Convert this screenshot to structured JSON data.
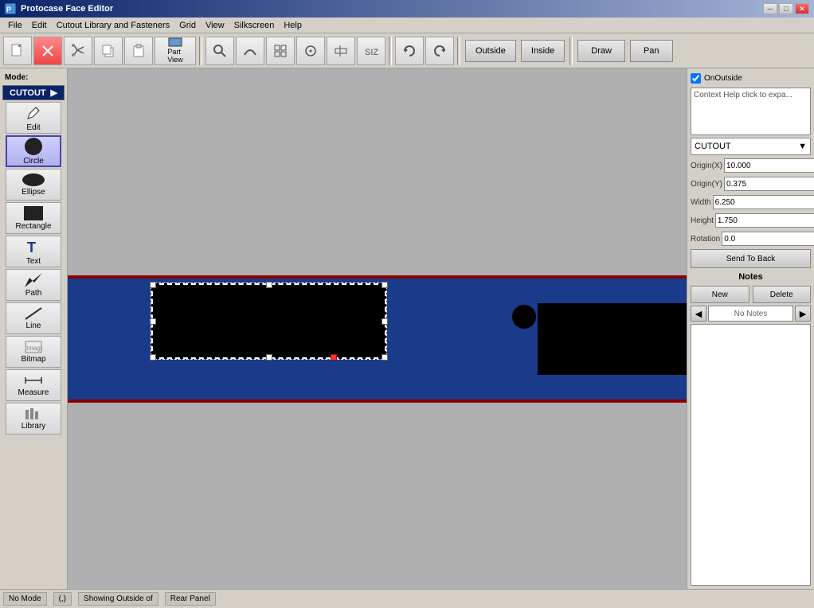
{
  "window": {
    "title": "Protocase Face Editor",
    "icon": "P"
  },
  "menu": {
    "items": [
      "File",
      "Edit",
      "Cutout Library and Fasteners",
      "Grid",
      "View",
      "Silkscreen",
      "Help"
    ]
  },
  "toolbar": {
    "buttons": [
      {
        "label": "🖼",
        "name": "new",
        "tooltip": "New"
      },
      {
        "label": "✕",
        "name": "close",
        "tooltip": "Close"
      },
      {
        "label": "✂",
        "name": "cut"
      },
      {
        "label": "📋",
        "name": "copy"
      },
      {
        "label": "📄",
        "name": "paste"
      },
      {
        "label": "Part\nView",
        "name": "part-view",
        "wide": true
      },
      {
        "label": "🔍",
        "name": "zoom"
      },
      {
        "label": "↩",
        "name": "curve"
      },
      {
        "label": "⊞",
        "name": "grid"
      },
      {
        "label": "⊡",
        "name": "snap"
      },
      {
        "label": "⊞",
        "name": "grid2"
      },
      {
        "label": "↩",
        "name": "undo"
      },
      {
        "label": "↪",
        "name": "redo"
      }
    ],
    "view_buttons": [
      "Outside",
      "Inside"
    ],
    "action_buttons": [
      "Draw",
      "Pan"
    ]
  },
  "mode": {
    "label": "Mode:",
    "active": "CUTOUT"
  },
  "tools": [
    {
      "label": "Edit",
      "name": "edit"
    },
    {
      "label": "Circle",
      "name": "circle",
      "active": true
    },
    {
      "label": "Ellipse",
      "name": "ellipse"
    },
    {
      "label": "Rectangle",
      "name": "rectangle"
    },
    {
      "label": "Text",
      "name": "text"
    },
    {
      "label": "Path",
      "name": "path"
    },
    {
      "label": "Line",
      "name": "line"
    },
    {
      "label": "Bitmap",
      "name": "bitmap"
    },
    {
      "label": "Measure",
      "name": "measure"
    },
    {
      "label": "Library",
      "name": "library"
    }
  ],
  "right_panel": {
    "on_outside_checked": true,
    "on_outside_label": "OnOutside",
    "context_help": "Context Help click to expa...",
    "cutout_dropdown": "CUTOUT",
    "origin_x_label": "Origin(X)",
    "origin_x_value": "10.000",
    "origin_y_label": "Origin(Y)",
    "origin_y_value": "0.375",
    "width_label": "Width",
    "width_value": "6.250",
    "height_label": "Height",
    "height_value": "1.750",
    "rotation_label": "Rotation",
    "rotation_value": "0.0",
    "send_to_back": "Send To Back",
    "notes_header": "Notes",
    "new_note_label": "New",
    "delete_note_label": "Delete",
    "no_notes_label": "No Notes",
    "notes_content": ""
  },
  "status_bar": {
    "items": [
      "No Mode",
      "(,)",
      "Showing Outside of",
      "Rear Panel"
    ]
  },
  "canvas": {
    "background": "#b0b0b0",
    "panel_color": "#1a3a8a",
    "border_color": "#8b0000"
  }
}
